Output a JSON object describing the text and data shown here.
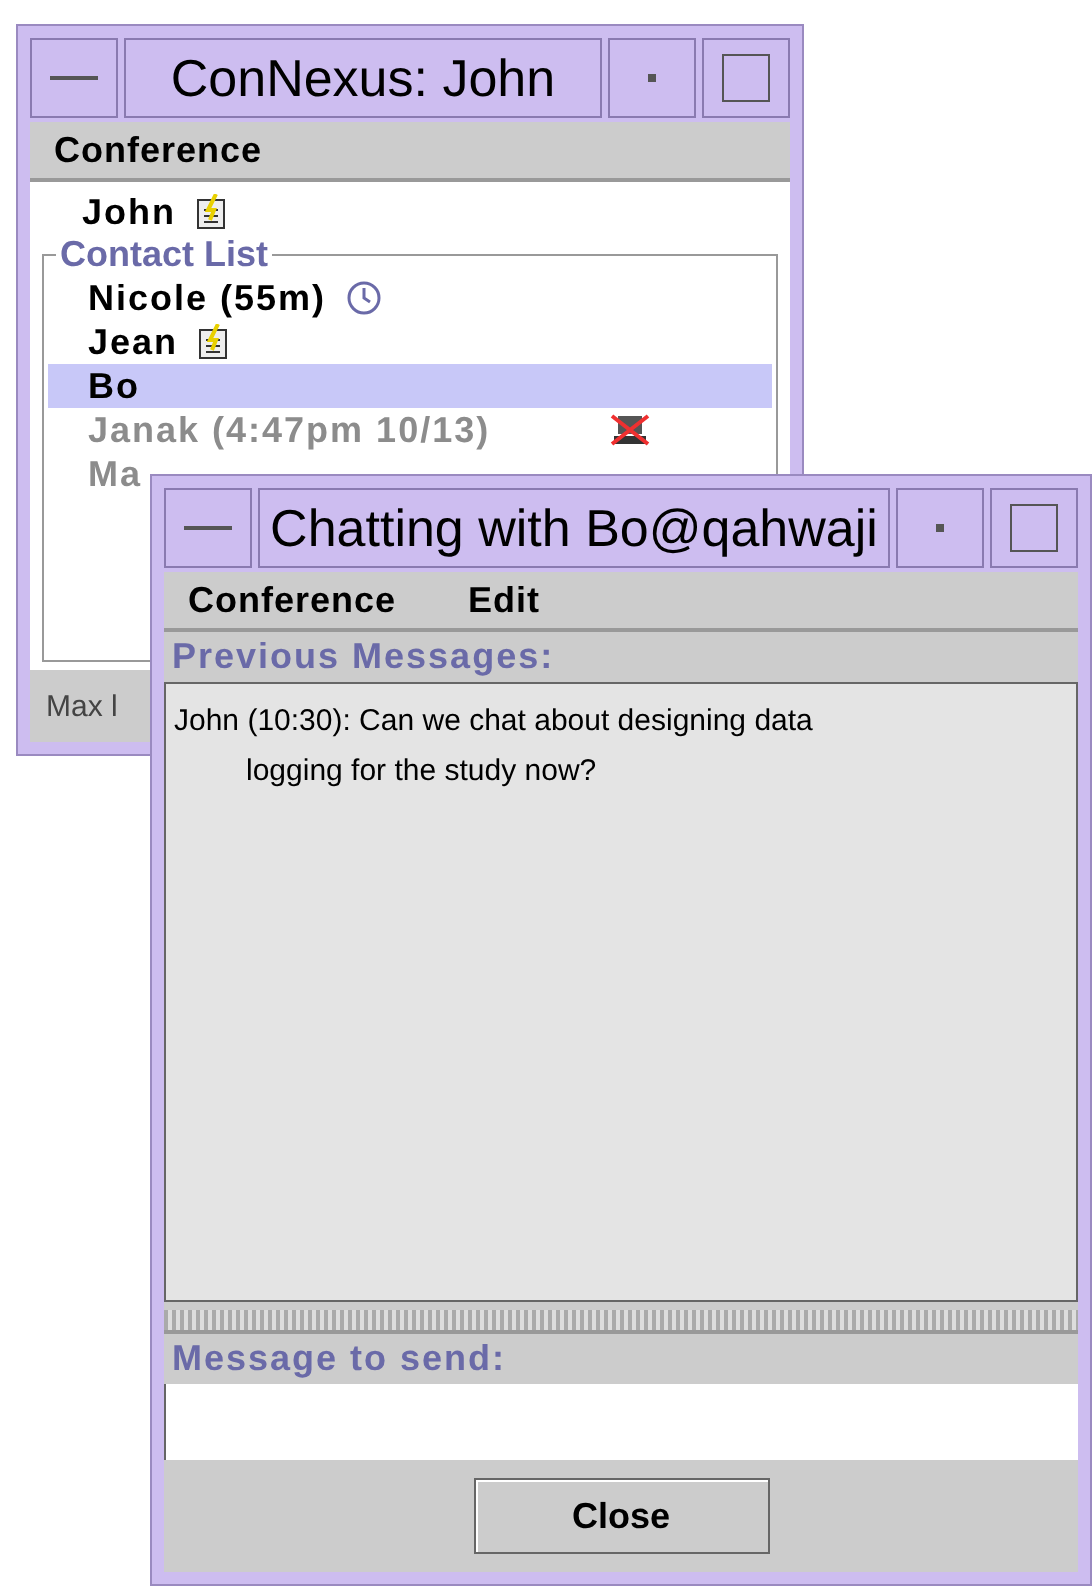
{
  "main_window": {
    "title": "ConNexus: John",
    "menu": [
      "Conference"
    ],
    "self": {
      "name": "John",
      "kind": "note"
    },
    "contact_list": {
      "title": "Contact List",
      "contacts": [
        {
          "name": "Nicole (55m)",
          "kind": "clock",
          "offline": false,
          "selected": false
        },
        {
          "name": "Jean",
          "kind": "note",
          "offline": false,
          "selected": false
        },
        {
          "name": "Bo",
          "kind": "none",
          "offline": false,
          "selected": true
        },
        {
          "name": "Janak (4:47pm 10/13)",
          "kind": "away",
          "offline": true,
          "selected": false
        },
        {
          "name": "Ma",
          "kind": "none",
          "offline": true,
          "selected": false
        }
      ]
    },
    "status": "Max l"
  },
  "chat_window": {
    "title": "Chatting with Bo@qahwaji",
    "menu": [
      "Conference",
      "Edit"
    ],
    "previous_label": "Previous Messages:",
    "messages": [
      "John (10:30): Can we chat about designing data logging for the study now?"
    ],
    "send_label": "Message to send:",
    "buttons": [
      "Close"
    ]
  }
}
